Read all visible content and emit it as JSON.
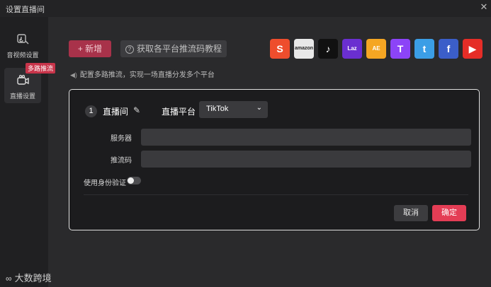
{
  "window": {
    "title": "设置直播间",
    "close_glyph": "✕"
  },
  "sidebar": {
    "items": [
      {
        "label": "音视频设置",
        "icon": "audio-video-icon"
      },
      {
        "label": "直播设置",
        "icon": "live-camera-icon"
      }
    ],
    "badge": "多路推流"
  },
  "toolbar": {
    "add_label": "+ 新增",
    "tutorial_label": "获取各平台推流码教程",
    "tip": "配置多路推流，实现一场直播分发多个平台"
  },
  "platforms": [
    {
      "name": "shopee",
      "glyph": "S",
      "color": "#ee4d2d"
    },
    {
      "name": "amazon",
      "glyph": "amazon",
      "color": "#e8e8e8"
    },
    {
      "name": "tiktok",
      "glyph": "♪",
      "color": "#111111"
    },
    {
      "name": "lazada",
      "glyph": "Laz",
      "color": "#6a2fd0"
    },
    {
      "name": "aliexpress",
      "glyph": "AE",
      "color": "#f5a623"
    },
    {
      "name": "twitch",
      "glyph": "T",
      "color": "#8c44f7"
    },
    {
      "name": "twitter",
      "glyph": "t",
      "color": "#3b9ee6"
    },
    {
      "name": "facebook",
      "glyph": "f",
      "color": "#3b5ec9"
    },
    {
      "name": "youtube",
      "glyph": "▶",
      "color": "#e52d27"
    }
  ],
  "card": {
    "index": "1",
    "room_label": "直播间",
    "platform_label": "直播平台",
    "platform_value": "TikTok",
    "server_label": "服务器",
    "server_value": "",
    "key_label": "推流码",
    "key_value": "",
    "auth_label": "使用身份验证",
    "auth_enabled": false,
    "cancel_label": "取消",
    "confirm_label": "确定"
  },
  "brand": {
    "name": "大数跨境"
  }
}
